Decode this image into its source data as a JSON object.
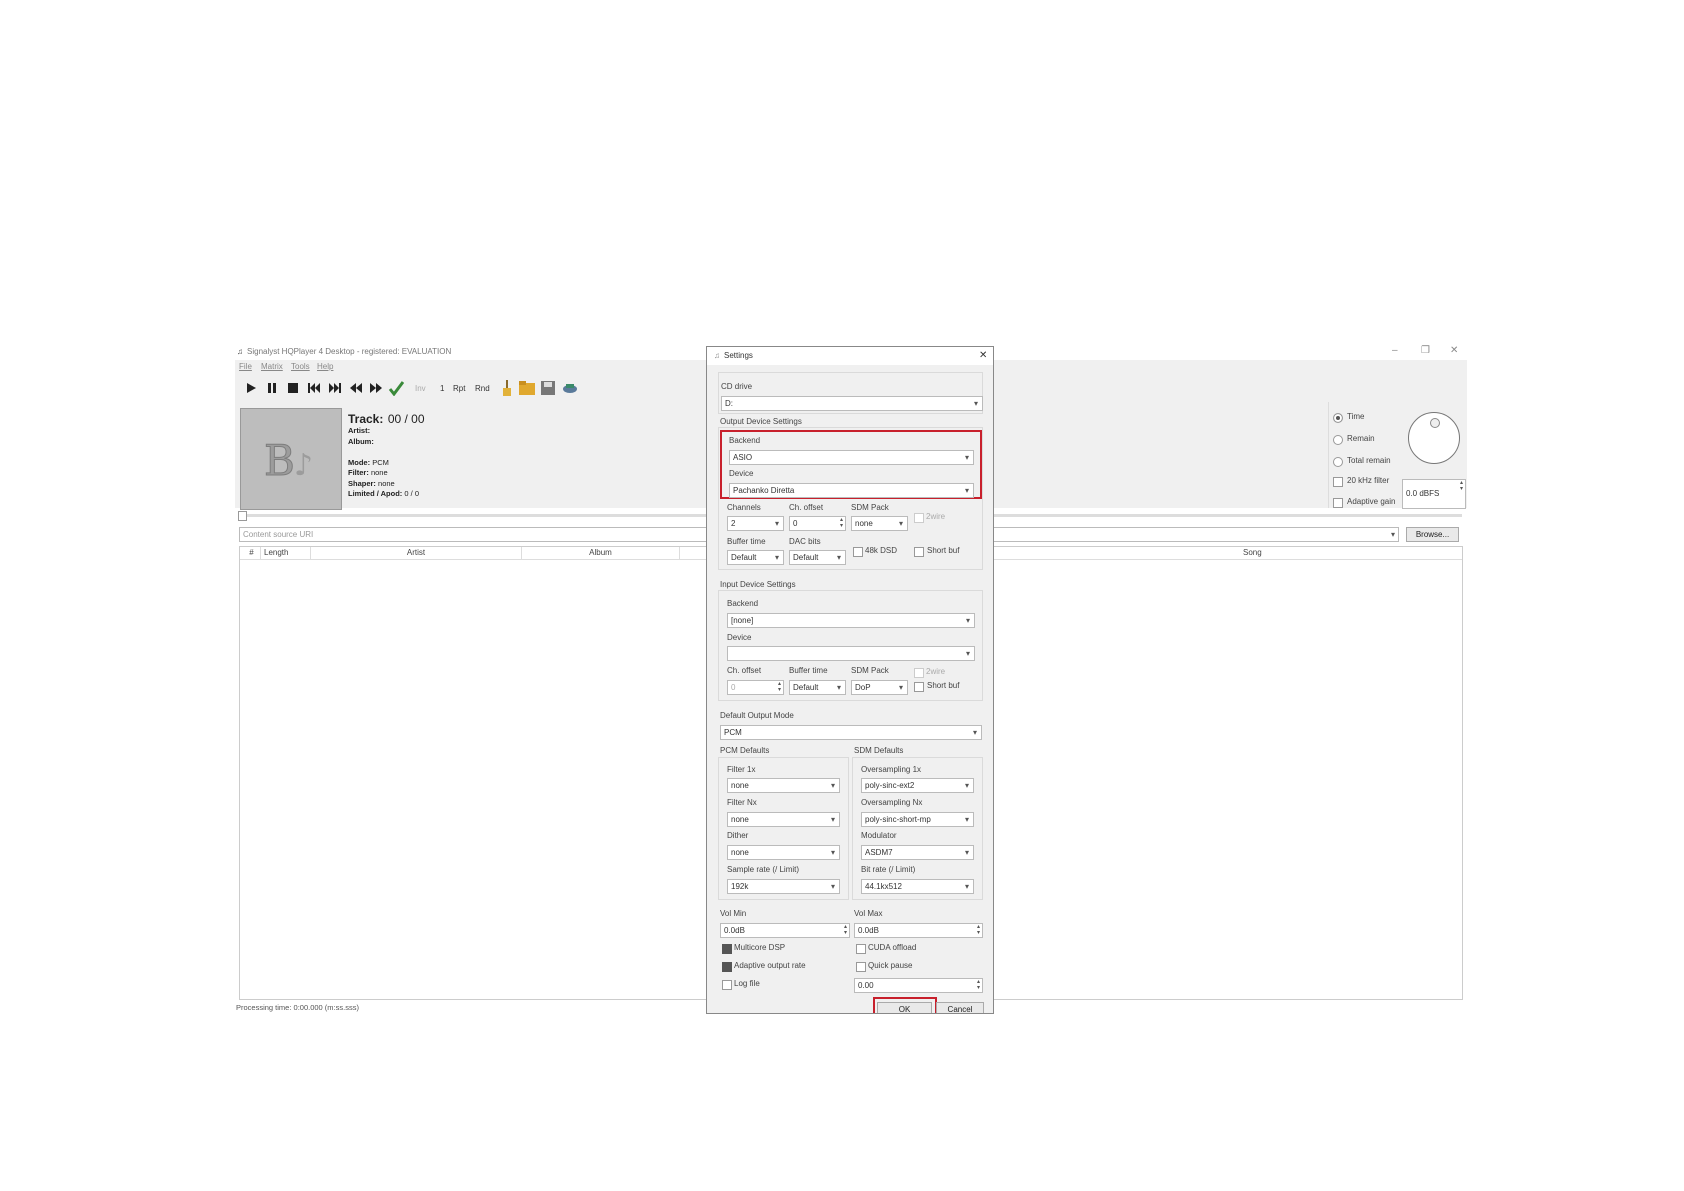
{
  "main": {
    "title": "Signalyst HQPlayer 4 Desktop - registered: EVALUATION",
    "menu": [
      "File",
      "Matrix",
      "Tools",
      "Help"
    ],
    "toolbar": {
      "inv": "Inv",
      "one": "1",
      "rpt": "Rpt",
      "rnd": "Rnd"
    },
    "track": {
      "label": "Track:",
      "value": "00 / 00"
    },
    "meta": {
      "artist": "Artist:",
      "album": "Album:",
      "mode_label": "Mode:",
      "mode_value": "PCM",
      "filter_label": "Filter:",
      "filter_value": "none",
      "shaper_label": "Shaper:",
      "shaper_value": "none",
      "limited_label": "Limited / Apod:",
      "limited_value": "0 / 0"
    },
    "right_panel": {
      "time": "Time",
      "remain": "Remain",
      "total_remain": "Total remain",
      "khz_filter": "20 kHz filter",
      "adaptive_gain": "Adaptive gain",
      "volume": "0.0 dBFS"
    },
    "content_source_placeholder": "Content source URI",
    "browse": "Browse...",
    "columns": [
      "#",
      "Length",
      "Artist",
      "Album",
      "Song"
    ],
    "status": "Processing time: 0:00.000 (m:ss.sss)"
  },
  "dialog": {
    "title": "Settings",
    "cd_drive_label": "CD drive",
    "cd_drive_value": "D:",
    "output_section": "Output Device Settings",
    "out_backend_label": "Backend",
    "out_backend_value": "ASIO",
    "out_device_label": "Device",
    "out_device_value": "Pachanko Diretta",
    "channels_label": "Channels",
    "channels_value": "2",
    "ch_offset_label": "Ch. offset",
    "ch_offset_value": "0",
    "sdm_pack_label": "SDM Pack",
    "sdm_pack_value": "none",
    "twowire": "2wire",
    "buffer_time_label": "Buffer time",
    "buffer_time_value": "Default",
    "dac_bits_label": "DAC bits",
    "dac_bits_value": "Default",
    "dsd48k": "48k DSD",
    "short_buf": "Short buf",
    "input_section": "Input Device Settings",
    "in_backend_label": "Backend",
    "in_backend_value": "[none]",
    "in_device_label": "Device",
    "in_device_value": "",
    "in_ch_offset_label": "Ch. offset",
    "in_ch_offset_value": "0",
    "in_buffer_time_label": "Buffer time",
    "in_buffer_time_value": "Default",
    "in_sdm_pack_label": "SDM Pack",
    "in_sdm_pack_value": "DoP",
    "in_twowire": "2wire",
    "in_short_buf": "Short buf",
    "default_output_mode_label": "Default Output Mode",
    "default_output_mode_value": "PCM",
    "pcm_defaults": "PCM Defaults",
    "sdm_defaults": "SDM Defaults",
    "filter1x_label": "Filter 1x",
    "filter1x_value": "none",
    "filterNx_label": "Filter Nx",
    "filterNx_value": "none",
    "dither_label": "Dither",
    "dither_value": "none",
    "samplerate_label": "Sample rate (/ Limit)",
    "samplerate_value": "192k",
    "os1x_label": "Oversampling 1x",
    "os1x_value": "poly-sinc-ext2",
    "osNx_label": "Oversampling Nx",
    "osNx_value": "poly-sinc-short-mp",
    "modulator_label": "Modulator",
    "modulator_value": "ASDM7",
    "bitrate_label": "Bit rate (/ Limit)",
    "bitrate_value": "44.1kx512",
    "volmin_label": "Vol Min",
    "volmin_value": "0.0dB",
    "volmax_label": "Vol Max",
    "volmax_value": "0.0dB",
    "multicore": "Multicore DSP",
    "cuda": "CUDA offload",
    "adaptive_rate": "Adaptive output rate",
    "quick_pause": "Quick pause",
    "log_file": "Log file",
    "log_value": "0.00",
    "ok": "OK",
    "cancel": "Cancel"
  },
  "colors": {
    "highlight": "#c8202c",
    "panel": "#f0f0f0"
  }
}
